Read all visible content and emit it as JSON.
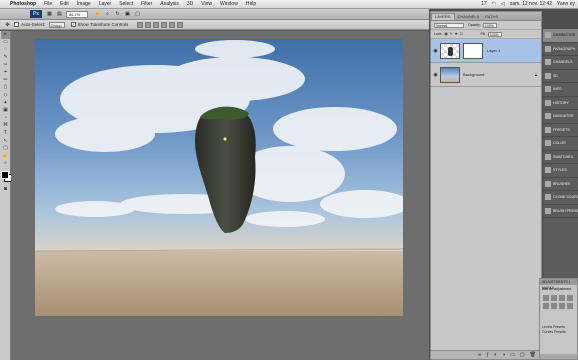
{
  "menubar": {
    "app_name": "Photoshop",
    "items": [
      "File",
      "Edit",
      "Image",
      "Layer",
      "Select",
      "Filter",
      "Analysis",
      "3D",
      "View",
      "Window",
      "Help"
    ],
    "status_number": "17",
    "datetime": "sam. 12 nov.  12:42",
    "user": "Yann ey"
  },
  "appbar": {
    "logo": "Ps",
    "zoom": "66,7%",
    "workspace": "ESSENTIALS",
    "search_label": "CS Live"
  },
  "options": {
    "auto_select_label": "Auto-Select:",
    "auto_select_value": "Group",
    "show_transform_label": "Show Transform Controls"
  },
  "tools": [
    "▸",
    "▭",
    "◌",
    "✎",
    "✂",
    "⌖",
    "✏",
    "▯",
    "◇",
    "✦",
    "▣",
    "◔",
    "⌘",
    "T",
    "↖",
    "▢",
    "☝",
    "⌕"
  ],
  "layers_panel": {
    "tabs": [
      "LAYERS",
      "CHANNELS",
      "PATHS"
    ],
    "blend_mode": "Normal",
    "opacity_label": "Opacity:",
    "opacity_value": "100%",
    "lock_label": "Lock:",
    "fill_label": "Fill:",
    "fill_value": "100%",
    "layers": [
      {
        "name": "Layer 1",
        "selected": true
      },
      {
        "name": "Background",
        "selected": false
      }
    ],
    "footer_icons": [
      "link-icon",
      "fx-icon",
      "mask-icon",
      "adjust-icon",
      "folder-icon",
      "new-icon",
      "trash-icon"
    ]
  },
  "dock": {
    "items": [
      "CHARACTER",
      "PARAGRAPH",
      "CHANNELS",
      "3D",
      "INFO",
      "HISTORY",
      "NAVIGATOR",
      "PRESETS",
      "COLOR",
      "SWATCHES",
      "STYLES",
      "BRUSHES",
      "CLONE SOURCE",
      "BRUSH PRESETS"
    ]
  },
  "adjustments": {
    "header": "ADJUSTMENTS | MASKS",
    "title": "Add an adjustment",
    "rows": [
      "Levels Presets",
      "Curves Presets"
    ]
  }
}
